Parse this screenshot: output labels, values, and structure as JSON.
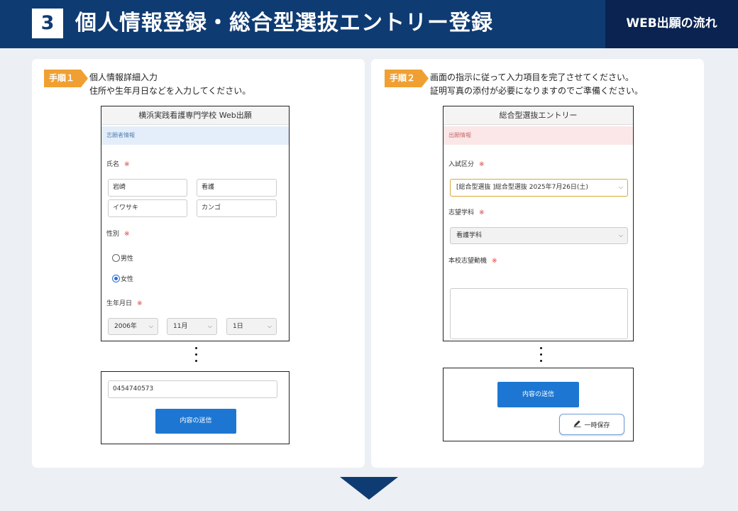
{
  "header": {
    "step_number": "3",
    "title": "個人情報登録・総合型選抜エントリー登録",
    "tag": "WEB出願の流れ",
    "colors": {
      "header_bg": "#0f3b73",
      "tag_bg": "#0a2350",
      "badge": "#f0a032",
      "primary_button": "#1d77d2"
    }
  },
  "step1": {
    "badge": "手順１",
    "instruction_line1": "個人情報詳細入力",
    "instruction_line2": "住所や生年月日などを入力してください。",
    "form": {
      "title": "横浜実践看護専門学校 Web出願",
      "section": "志願者情報",
      "name_label": "氏名",
      "required_mark": "※",
      "last_name": "岩崎",
      "first_name": "看護",
      "last_name_kana": "イワサキ",
      "first_name_kana": "カンゴ",
      "gender_label": "性別",
      "gender_options": [
        "男性",
        "女性"
      ],
      "gender_selected": "女性",
      "birthdate_label": "生年月日",
      "birth_year": "2006年",
      "birth_month": "11月",
      "birth_day": "1日"
    },
    "form_bottom": {
      "phone": "0454740573",
      "submit_label": "内容の送信"
    }
  },
  "step2": {
    "badge": "手順２",
    "instruction_line1": "画面の指示に従って入力項目を完了させてください。",
    "instruction_line2": "証明写真の添付が必要になりますのでご準備ください。",
    "form": {
      "title": "総合型選抜エントリー",
      "section": "出願情報",
      "exam_type_label": "入試区分",
      "required_mark": "※",
      "exam_type_value": "[総合型選抜 ]総合型選抜 2025年7月26日(土)",
      "department_label": "志望学科",
      "department_value": "看護学科",
      "motivation_label": "本校志望動機",
      "motivation_value": ""
    },
    "form_bottom": {
      "submit_label": "内容の送信",
      "save_label": "一時保存"
    }
  },
  "icons": {
    "chevron": "chevron-down-icon",
    "pencil": "pencil-icon",
    "more": "vertical-ellipsis-icon",
    "next": "down-arrow-icon"
  }
}
